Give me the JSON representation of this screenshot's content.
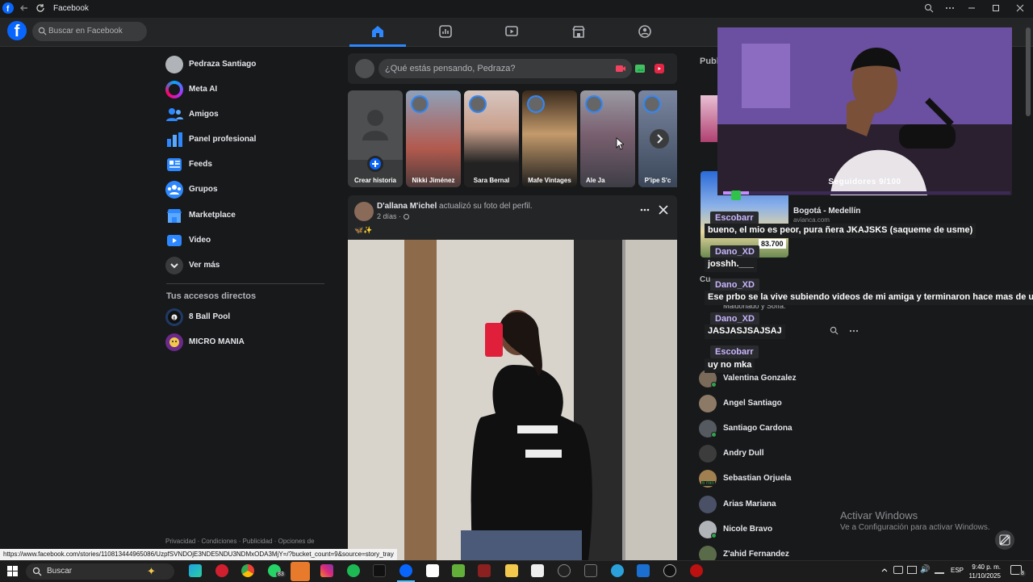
{
  "window": {
    "title": "Facebook"
  },
  "header": {
    "search_placeholder": "Buscar en Facebook"
  },
  "sidebar": {
    "items": [
      {
        "label": "Pedraza Santiago",
        "icon": "profile-avatar"
      },
      {
        "label": "Meta AI",
        "icon": "meta-ai-icon"
      },
      {
        "label": "Amigos",
        "icon": "friends-icon"
      },
      {
        "label": "Panel profesional",
        "icon": "dashboard-icon"
      },
      {
        "label": "Feeds",
        "icon": "feeds-icon"
      },
      {
        "label": "Grupos",
        "icon": "groups-icon"
      },
      {
        "label": "Marketplace",
        "icon": "marketplace-icon"
      },
      {
        "label": "Video",
        "icon": "video-icon"
      },
      {
        "label": "Ver más",
        "icon": "chevron-down-icon"
      }
    ],
    "shortcuts_heading": "Tus accesos directos",
    "shortcuts": [
      {
        "label": "8 Ball Pool"
      },
      {
        "label": "MICRO MANIA"
      }
    ],
    "footer": "Privacidad · Condiciones · Publicidad · Opciones de"
  },
  "composer": {
    "placeholder": "¿Qué estás pensando, Pedraza?"
  },
  "stories": [
    {
      "name": "Crear historia"
    },
    {
      "name": "Nikki Jiménez"
    },
    {
      "name": "Sara Bernal"
    },
    {
      "name": "Mafe Vintages"
    },
    {
      "name": "Ale Ja"
    },
    {
      "name": "P'ipe S'c"
    }
  ],
  "post": {
    "author": "D'allana M'ichel",
    "action": "actualizó su foto del perfil.",
    "time": "2 días · ",
    "emoji": "🦋✨"
  },
  "right": {
    "sponsored_heading": "Publ",
    "ad_title": "Bogotá - Medellín",
    "ad_domain": "avianca.com",
    "ad_price": "83.700",
    "section_fragment": "Cu",
    "birthday_text": "Maldonado y Sofía.",
    "contacts": [
      {
        "name": "Valentina Gonzalez",
        "online": true,
        "color": "#7a6a5a"
      },
      {
        "name": "Angel Santiago",
        "online": false,
        "color": "#8c7a66"
      },
      {
        "name": "Santiago Cardona",
        "online": true,
        "color": "#555a60"
      },
      {
        "name": "Andry Dull",
        "online": false,
        "color": "#3c3c3c"
      },
      {
        "name": "Sebastian Orjuela",
        "online": false,
        "color": "#a08050",
        "badge": "6 min"
      },
      {
        "name": "Arias Mariana",
        "online": false,
        "color": "#4a5066"
      },
      {
        "name": "Nicole Bravo",
        "online": true,
        "color": "#b0b3b8"
      },
      {
        "name": "Z'ahid Fernandez",
        "online": false,
        "color": "#5a6b4a"
      }
    ]
  },
  "stream_overlay": {
    "followers": "Seguidores 9/100",
    "chat": [
      {
        "user": "Escobarr",
        "message": "bueno, el mio es peor, pura ñera JKAJSKS (saqueme de usme)"
      },
      {
        "user": "Dano_XD",
        "message": "josshh.___"
      },
      {
        "user": "Dano_XD",
        "message": "Ese prbo se la vive subiendo videos de mi amiga y terminaron hace mas de un año"
      },
      {
        "user": "Dano_XD",
        "message": "JASJASJSAJSAJ"
      },
      {
        "user": "Escobarr",
        "message": "uy no mka"
      }
    ]
  },
  "watermark": {
    "line1": "Activar Windows",
    "line2": "Ve a Configuración para activar Windows."
  },
  "status_url": "https://www.facebook.com/stories/110813444965086/UzpfSVNDOjE3NDE5NDU3NDMxODA3MjY=/?bucket_count=9&source=story_tray",
  "taskbar": {
    "search": "Buscar",
    "whatsapp_badge": "83",
    "lang": "ESP",
    "time": "9:40 p. m.",
    "date": "11/10/2025",
    "notif_count": "8"
  },
  "colors": {
    "accent": "#0866ff",
    "bg": "#18191a",
    "surface": "#242526",
    "online": "#31a24c"
  }
}
